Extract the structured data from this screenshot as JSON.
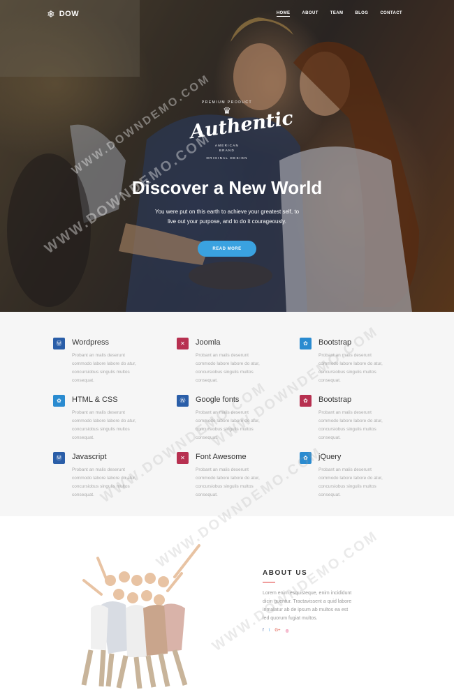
{
  "brand": {
    "name": "DOW",
    "icon": "snowflake-icon"
  },
  "nav": {
    "items": [
      "HOME",
      "ABOUT",
      "TEAM",
      "BLOG",
      "CONTACT"
    ],
    "active": "HOME"
  },
  "hero": {
    "badge_top": "PREMIUM PRODUCT",
    "badge_script": "Authentic",
    "badge_mid": "AMERICAN",
    "badge_mid2": "BRAND",
    "badge_bottom": "ORIGINAL DESIGN",
    "title": "Discover a New World",
    "subtitle_line1": "You were put on this earth to achieve your greatest self, to",
    "subtitle_line2": "live out your purpose, and to do it courageously.",
    "button": "READ MORE"
  },
  "features": [
    {
      "title": "Wordpress",
      "icon": "wordpress-icon",
      "color": "#2a5ea8",
      "glyph": "Ⓦ"
    },
    {
      "title": "Joomla",
      "icon": "joomla-icon",
      "color": "#b73050",
      "glyph": "✕"
    },
    {
      "title": "Bootstrap",
      "icon": "bootstrap-icon",
      "color": "#2a8bd0",
      "glyph": "✿"
    },
    {
      "title": "HTML & CSS",
      "icon": "html-css-icon",
      "color": "#2a8bd0",
      "glyph": "✿"
    },
    {
      "title": "Google fonts",
      "icon": "google-fonts-icon",
      "color": "#2a5ea8",
      "glyph": "Ⓦ"
    },
    {
      "title": "Bootstrap",
      "icon": "bootstrap-icon",
      "color": "#b73050",
      "glyph": "✿"
    },
    {
      "title": "Javascript",
      "icon": "javascript-icon",
      "color": "#2a5ea8",
      "glyph": "Ⓦ"
    },
    {
      "title": "Font Awesome",
      "icon": "font-awesome-icon",
      "color": "#b73050",
      "glyph": "✕"
    },
    {
      "title": "jQuery",
      "icon": "jquery-icon",
      "color": "#2a8bd0",
      "glyph": "✿"
    }
  ],
  "feature_text": {
    "line1": "Probant an malis deserunt",
    "line2": "commodo labore labore do atur,",
    "line3": "concursiobus singulis multos",
    "line4": "consequat."
  },
  "about": {
    "title": "ABOUT US",
    "line1": "Lorem enim esquisteque, enim incididunt",
    "line2": "dicin guentur. Tractavissent a quid labore",
    "line3": "inmalatur ab de ipsum ab multos ea est",
    "line4": "led quorum fugiat multos.",
    "socials": [
      {
        "glyph": "f",
        "color": "#3b5998"
      },
      {
        "glyph": "t",
        "color": "#55acee"
      },
      {
        "glyph": "G+",
        "color": "#dd4b39"
      },
      {
        "glyph": "◎",
        "color": "#e1306c"
      }
    ]
  },
  "watermark": {
    "text": "WWW.DOWNDEMO.COM"
  }
}
